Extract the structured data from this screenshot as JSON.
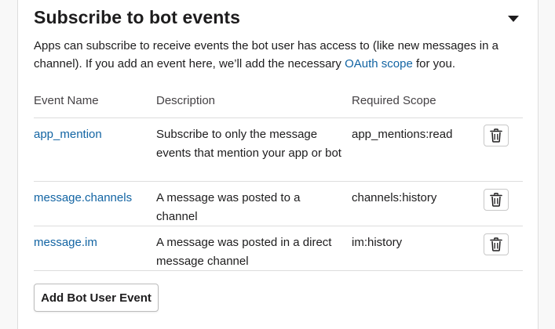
{
  "section": {
    "title": "Subscribe to bot events",
    "description_before_link": "Apps can subscribe to receive events the bot user has access to (like new messages in a channel). If you add an event here, we’ll add the necessary ",
    "link_text": "OAuth scope",
    "description_after_link": " for you."
  },
  "table": {
    "headers": {
      "event_name": "Event Name",
      "description": "Description",
      "required_scope": "Required Scope"
    },
    "rows": [
      {
        "event_name": "app_mention",
        "description": "Subscribe to only the message events that mention your app or bot",
        "scope": "app_mentions:read",
        "action_icon": "trash-icon"
      },
      {
        "event_name": "message.channels",
        "description": "A message was posted to a channel",
        "scope": "channels:history",
        "action_icon": "trash-icon"
      },
      {
        "event_name": "message.im",
        "description": "A message was posted in a direct message channel",
        "scope": "im:history",
        "action_icon": "trash-icon"
      }
    ]
  },
  "add_button_label": "Add Bot User Event",
  "colors": {
    "link": "#1264a3",
    "text": "#1d1c1d",
    "border": "#dddddd"
  }
}
